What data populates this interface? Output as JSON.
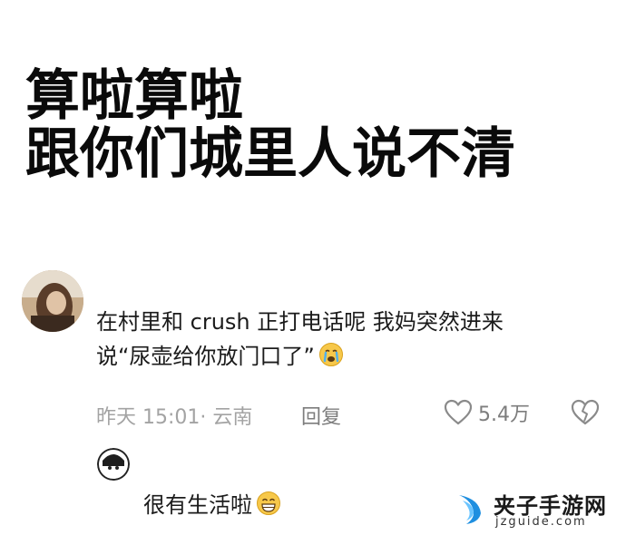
{
  "headline": {
    "line1": "算啦算啦",
    "line2": "跟你们城里人说不清"
  },
  "comment": {
    "text_line1": "在村里和 crush 正打电话呢  我妈突然进来",
    "text_line2": "说“尿壶给你放门口了”",
    "emoji": "crying-face-emoji",
    "time_location": "昨天 15:01· 云南",
    "reply_label": "回复",
    "like_count": "5.4万"
  },
  "reply": {
    "text": "很有生活啦",
    "emoji": "grinning-face-emoji"
  },
  "watermark": {
    "title": "夹子手游网",
    "url": "jzguide.com"
  },
  "colors": {
    "text": "#1b1b1b",
    "meta": "#a3a3a3",
    "background": "#ffffff"
  }
}
